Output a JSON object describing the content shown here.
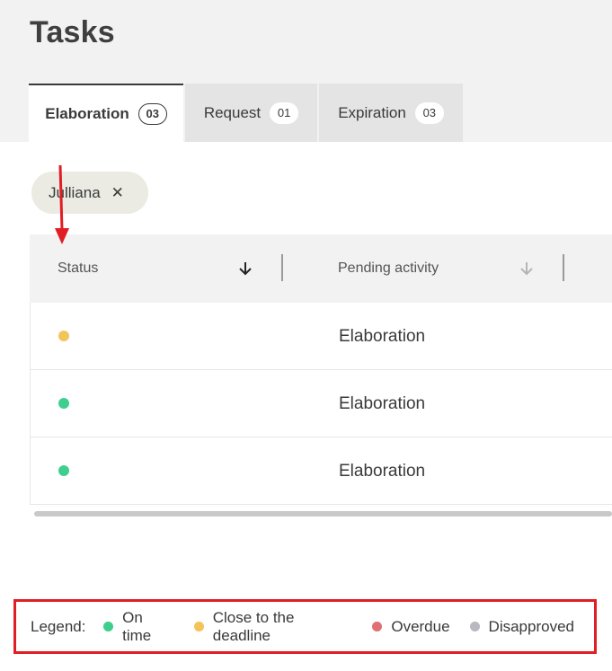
{
  "page": {
    "title": "Tasks"
  },
  "tabs": [
    {
      "label": "Elaboration",
      "count": "03",
      "active": true
    },
    {
      "label": "Request",
      "count": "01",
      "active": false
    },
    {
      "label": "Expiration",
      "count": "03",
      "active": false
    }
  ],
  "filter_chip": {
    "label": "Julliana",
    "remove_glyph": "✕"
  },
  "table": {
    "columns": [
      {
        "label": "Status",
        "sort_icon": "arrow-down-icon"
      },
      {
        "label": "Pending activity",
        "sort_icon": "arrow-down-icon"
      }
    ],
    "rows": [
      {
        "status": "close-to-deadline",
        "status_color": "#f2c45a",
        "activity": "Elaboration"
      },
      {
        "status": "on-time",
        "status_color": "#3ecf8e",
        "activity": "Elaboration"
      },
      {
        "status": "on-time",
        "status_color": "#3ecf8e",
        "activity": "Elaboration"
      }
    ]
  },
  "legend": {
    "title": "Legend:",
    "items": [
      {
        "label": "On time",
        "color": "#3ecf8e"
      },
      {
        "label": "Close to the deadline",
        "color": "#f2c45a"
      },
      {
        "label": "Overdue",
        "color": "#e07072"
      },
      {
        "label": "Disapproved",
        "color": "#b8b8c0"
      }
    ]
  },
  "colors": {
    "annotation_red": "#e01e24",
    "active_sort": "#222222",
    "inactive_sort": "#b5b5b5"
  }
}
